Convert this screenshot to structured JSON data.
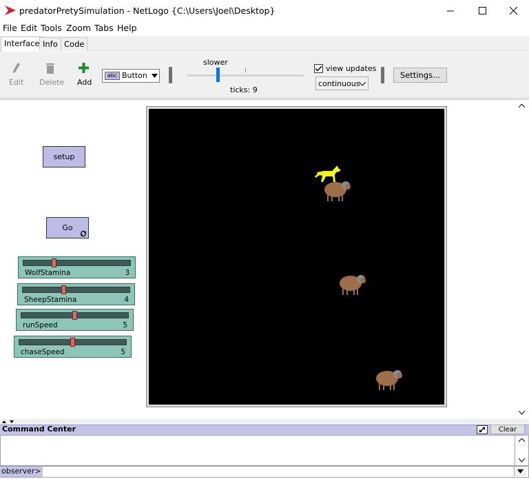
{
  "window": {
    "title": "predatorPretySimulation - NetLogo {C:\\Users\\Joel\\Desktop}",
    "controls": [
      "minimize",
      "maximize",
      "close"
    ]
  },
  "menu": [
    "File",
    "Edit",
    "Tools",
    "Zoom",
    "Tabs",
    "Help"
  ],
  "tabs": [
    {
      "label": "Interface",
      "active": true
    },
    {
      "label": "Info",
      "active": false
    },
    {
      "label": "Code",
      "active": false
    }
  ],
  "toolbar": {
    "edit_label": "Edit",
    "delete_label": "Delete",
    "add_label": "Add",
    "widget_type": "Button",
    "widget_type_icon": "abc",
    "speed_label": "slower",
    "ticks_label": "ticks: 9",
    "view_updates_label": "view updates",
    "view_updates_checked": true,
    "update_mode": "continuous",
    "settings_label": "Settings..."
  },
  "interface": {
    "setup_button": "setup",
    "go_button": "Go",
    "sliders": [
      {
        "name": "WolfStamina",
        "value": "3",
        "fraction": 0.28
      },
      {
        "name": "SheepStamina",
        "value": "4",
        "fraction": 0.38
      },
      {
        "name": "runSpeed",
        "value": "5",
        "fraction": 0.5
      },
      {
        "name": "chaseSpeed",
        "value": "5",
        "fraction": 0.5
      }
    ],
    "world": {
      "background": "#000000",
      "agents": [
        {
          "kind": "wolf",
          "color": "#f2f21c"
        },
        {
          "kind": "sheep",
          "color": "#9d6e48"
        },
        {
          "kind": "sheep",
          "color": "#9d6e48"
        },
        {
          "kind": "sheep",
          "color": "#9d6e48"
        }
      ]
    }
  },
  "command_center": {
    "title": "Command Center",
    "clear_label": "Clear",
    "prompt": "observer>",
    "input_value": ""
  },
  "colors": {
    "button_bg": "#bcbce6",
    "slider_bg": "#8dc6b8",
    "speed_thumb": "#1a72c8",
    "command_header": "#c4c4e8",
    "logo_red": "#d8202a"
  }
}
